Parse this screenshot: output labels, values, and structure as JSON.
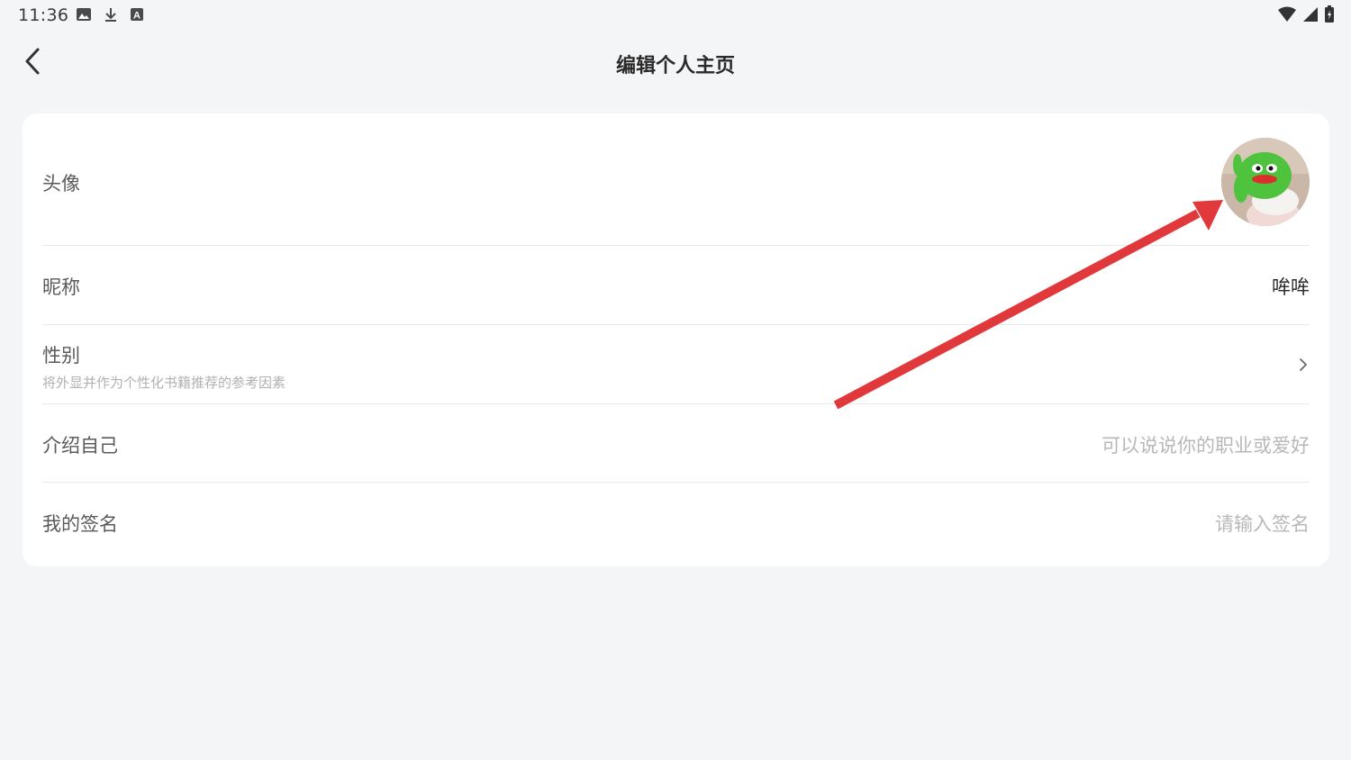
{
  "status_bar": {
    "time": "11:36",
    "left_icons": [
      "image-icon",
      "download-icon",
      "a-badge-icon"
    ],
    "right_icons": [
      "wifi-icon",
      "signal-icon",
      "battery-icon"
    ]
  },
  "nav": {
    "title": "编辑个人主页",
    "back_icon": "chevron-left-icon"
  },
  "profile": {
    "avatar": {
      "label": "头像"
    },
    "nickname": {
      "label": "昵称",
      "value": "哞哞"
    },
    "gender": {
      "label": "性别",
      "hint": "将外显并作为个性化书籍推荐的参考因素",
      "chevron_icon": "chevron-right-icon"
    },
    "intro": {
      "label": "介绍自己",
      "placeholder": "可以说说你的职业或爱好"
    },
    "signature": {
      "label": "我的签名",
      "placeholder": "请输入签名"
    }
  },
  "colors": {
    "background": "#f4f5f7",
    "card": "#ffffff",
    "annotation_arrow": "#e0383b",
    "placeholder_text": "#b8b8b8"
  }
}
